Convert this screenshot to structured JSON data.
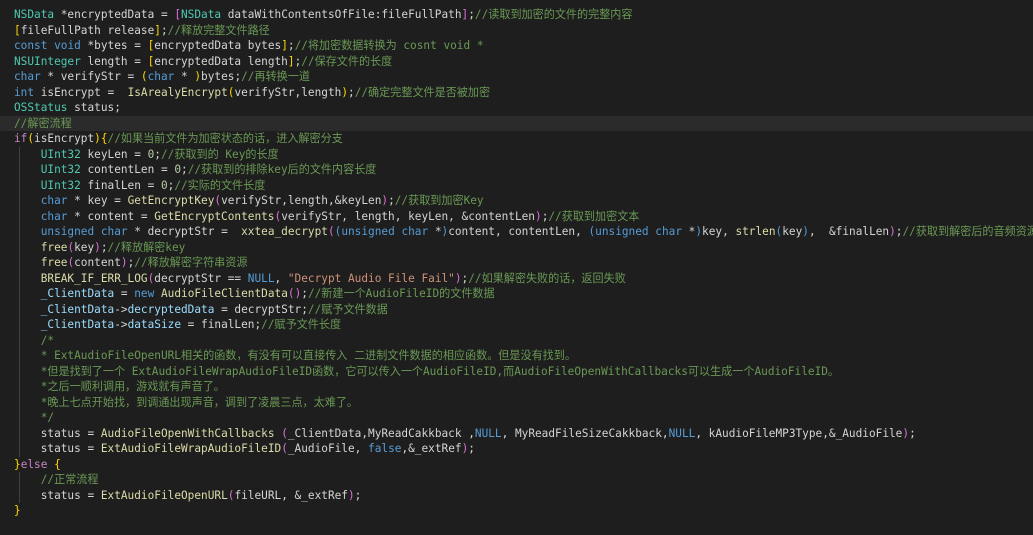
{
  "colors": {
    "background": "#1e1e1e",
    "default": "#d4d4d4",
    "type": "#4ec9b0",
    "keyword": "#569cd6",
    "control": "#c586c0",
    "function": "#dcdcaa",
    "variable": "#9cdcfe",
    "string": "#ce9178",
    "number": "#b5cea8",
    "comment": "#6a9955",
    "brace": "#ffd700",
    "paren": "#da70d6",
    "indent_guide": "#404040",
    "current_line": "#2b2b2b"
  },
  "lines": [
    {
      "indent": 0,
      "tokens": [
        [
          "NSData",
          "type"
        ],
        [
          " *encryptedData = ",
          "default"
        ],
        [
          "[",
          "paren"
        ],
        [
          "NSData",
          "type"
        ],
        [
          " dataWithContentsOfFile:fileFullPath",
          "default"
        ],
        [
          "]",
          "paren"
        ],
        [
          ";",
          "default"
        ],
        [
          "//读取到加密的文件的完整内容",
          "comment"
        ]
      ]
    },
    {
      "indent": 0,
      "tokens": [
        [
          "[",
          "brace"
        ],
        [
          "fileFullPath release",
          "default"
        ],
        [
          "]",
          "brace"
        ],
        [
          ";",
          "default"
        ],
        [
          "//释放完整文件路径",
          "comment"
        ]
      ]
    },
    {
      "indent": 0,
      "tokens": [
        [
          "const",
          "keyword"
        ],
        [
          " ",
          "default"
        ],
        [
          "void",
          "keyword"
        ],
        [
          " *bytes = ",
          "default"
        ],
        [
          "[",
          "brace"
        ],
        [
          "encryptedData bytes",
          "default"
        ],
        [
          "]",
          "brace"
        ],
        [
          ";",
          "default"
        ],
        [
          "//将加密数据转换为 cosnt void *",
          "comment"
        ]
      ]
    },
    {
      "indent": 0,
      "tokens": [
        [
          "NSUInteger",
          "type"
        ],
        [
          " length = ",
          "default"
        ],
        [
          "[",
          "brace"
        ],
        [
          "encryptedData length",
          "default"
        ],
        [
          "]",
          "brace"
        ],
        [
          ";",
          "default"
        ],
        [
          "//保存文件的长度",
          "comment"
        ]
      ]
    },
    {
      "indent": 0,
      "tokens": [
        [
          "char",
          "keyword"
        ],
        [
          " * verifyStr = ",
          "default"
        ],
        [
          "(",
          "brace"
        ],
        [
          "char",
          "keyword"
        ],
        [
          " * ",
          "default"
        ],
        [
          ")",
          "brace"
        ],
        [
          "bytes;",
          "default"
        ],
        [
          "//再转换一道",
          "comment"
        ]
      ]
    },
    {
      "indent": 0,
      "tokens": [
        [
          "int",
          "keyword"
        ],
        [
          " isEncrypt =  ",
          "default"
        ],
        [
          "IsArealyEncrypt",
          "function"
        ],
        [
          "(",
          "brace"
        ],
        [
          "verifyStr,length",
          "default"
        ],
        [
          ")",
          "brace"
        ],
        [
          ";",
          "default"
        ],
        [
          "//确定完整文件是否被加密",
          "comment"
        ]
      ]
    },
    {
      "indent": 0,
      "tokens": [
        [
          "OSStatus",
          "type"
        ],
        [
          " status;",
          "default"
        ]
      ]
    },
    {
      "indent": 0,
      "highlight": true,
      "tokens": [
        [
          "//解密流程",
          "comment"
        ]
      ]
    },
    {
      "indent": 0,
      "tokens": [
        [
          "if",
          "control"
        ],
        [
          "(",
          "brace"
        ],
        [
          "isEncrypt",
          "default"
        ],
        [
          ")",
          "brace"
        ],
        [
          "{",
          "brace"
        ],
        [
          "//如果当前文件为加密状态的话，进入解密分支",
          "comment"
        ]
      ]
    },
    {
      "indent": 1,
      "tokens": [
        [
          "UInt32",
          "type"
        ],
        [
          " keyLen = ",
          "default"
        ],
        [
          "0",
          "number"
        ],
        [
          ";",
          "default"
        ],
        [
          "//获取到的 Key的长度",
          "comment"
        ]
      ]
    },
    {
      "indent": 1,
      "tokens": [
        [
          "UInt32",
          "type"
        ],
        [
          " contentLen = ",
          "default"
        ],
        [
          "0",
          "number"
        ],
        [
          ";",
          "default"
        ],
        [
          "//获取到的排除key后的文件内容长度",
          "comment"
        ]
      ]
    },
    {
      "indent": 1,
      "tokens": [
        [
          "UInt32",
          "type"
        ],
        [
          " finalLen = ",
          "default"
        ],
        [
          "0",
          "number"
        ],
        [
          ";",
          "default"
        ],
        [
          "//实际的文件长度",
          "comment"
        ]
      ]
    },
    {
      "indent": 1,
      "tokens": [
        [
          "char",
          "keyword"
        ],
        [
          " * key = ",
          "default"
        ],
        [
          "GetEncryptKey",
          "function"
        ],
        [
          "(",
          "paren"
        ],
        [
          "verifyStr,length,&keyLen",
          "default"
        ],
        [
          ")",
          "paren"
        ],
        [
          ";",
          "default"
        ],
        [
          "//获取到加密Key",
          "comment"
        ]
      ]
    },
    {
      "indent": 1,
      "tokens": [
        [
          "char",
          "keyword"
        ],
        [
          " * content = ",
          "default"
        ],
        [
          "GetEncryptContents",
          "function"
        ],
        [
          "(",
          "paren"
        ],
        [
          "verifyStr, length, keyLen, &contentLen",
          "default"
        ],
        [
          ")",
          "paren"
        ],
        [
          ";",
          "default"
        ],
        [
          "//获取到加密文本",
          "comment"
        ]
      ]
    },
    {
      "indent": 1,
      "tokens": [
        [
          "unsigned",
          "keyword"
        ],
        [
          " ",
          "default"
        ],
        [
          "char",
          "keyword"
        ],
        [
          " * decryptStr =  ",
          "default"
        ],
        [
          "xxtea_decrypt",
          "function"
        ],
        [
          "(",
          "paren"
        ],
        [
          "(",
          "keyword"
        ],
        [
          "unsigned",
          "keyword"
        ],
        [
          " ",
          "default"
        ],
        [
          "char",
          "keyword"
        ],
        [
          " *",
          "default"
        ],
        [
          ")",
          "keyword"
        ],
        [
          "content, contentLen, ",
          "default"
        ],
        [
          "(",
          "keyword"
        ],
        [
          "unsigned",
          "keyword"
        ],
        [
          " ",
          "default"
        ],
        [
          "char",
          "keyword"
        ],
        [
          " *",
          "default"
        ],
        [
          ")",
          "keyword"
        ],
        [
          "key, ",
          "default"
        ],
        [
          "strlen",
          "function"
        ],
        [
          "(",
          "keyword"
        ],
        [
          "key",
          "default"
        ],
        [
          ")",
          "keyword"
        ],
        [
          ",  &finalLen",
          "default"
        ],
        [
          ")",
          "paren"
        ],
        [
          ";",
          "default"
        ],
        [
          "//获取到解密后的音频资源信息",
          "comment"
        ]
      ]
    },
    {
      "indent": 1,
      "tokens": [
        [
          "free",
          "function"
        ],
        [
          "(",
          "paren"
        ],
        [
          "key",
          "default"
        ],
        [
          ")",
          "paren"
        ],
        [
          ";",
          "default"
        ],
        [
          "//释放解密key",
          "comment"
        ]
      ]
    },
    {
      "indent": 1,
      "tokens": [
        [
          "free",
          "function"
        ],
        [
          "(",
          "paren"
        ],
        [
          "content",
          "default"
        ],
        [
          ")",
          "paren"
        ],
        [
          ";",
          "default"
        ],
        [
          "//释放解密字符串资源",
          "comment"
        ]
      ]
    },
    {
      "indent": 1,
      "tokens": [
        [
          "BREAK_IF_ERR_LOG",
          "function"
        ],
        [
          "(",
          "paren"
        ],
        [
          "decryptStr == ",
          "default"
        ],
        [
          "NULL",
          "keyword"
        ],
        [
          ", ",
          "default"
        ],
        [
          "\"Decrypt Audio File Fail\"",
          "string"
        ],
        [
          ")",
          "paren"
        ],
        [
          ";",
          "default"
        ],
        [
          "//如果解密失败的话，返回失败",
          "comment"
        ]
      ]
    },
    {
      "indent": 1,
      "tokens": [
        [
          "_ClientData",
          "variable"
        ],
        [
          " = ",
          "default"
        ],
        [
          "new",
          "keyword"
        ],
        [
          " ",
          "default"
        ],
        [
          "AudioFileClientData",
          "function"
        ],
        [
          "()",
          "paren"
        ],
        [
          ";",
          "default"
        ],
        [
          "//新建一个AudioFileID的文件数据",
          "comment"
        ]
      ]
    },
    {
      "indent": 1,
      "tokens": [
        [
          "_ClientData",
          "variable"
        ],
        [
          "->",
          "default"
        ],
        [
          "decryptedData",
          "variable"
        ],
        [
          " = decryptStr;",
          "default"
        ],
        [
          "//赋予文件数据",
          "comment"
        ]
      ]
    },
    {
      "indent": 1,
      "tokens": [
        [
          "_ClientData",
          "variable"
        ],
        [
          "->",
          "default"
        ],
        [
          "dataSize",
          "variable"
        ],
        [
          " = finalLen;",
          "default"
        ],
        [
          "//赋予文件长度",
          "comment"
        ]
      ]
    },
    {
      "indent": 1,
      "tokens": [
        [
          "/*",
          "comment"
        ]
      ]
    },
    {
      "indent": 1,
      "tokens": [
        [
          "* ExtAudioFileOpenURL相关的函数，有没有可以直接传入 二进制文件数据的相应函数。但是没有找到。",
          "comment"
        ]
      ]
    },
    {
      "indent": 1,
      "tokens": [
        [
          "*但是找到了一个 ExtAudioFileWrapAudioFileID函数，它可以传入一个AudioFileID,而AudioFileOpenWithCallbacks可以生成一个AudioFileID。",
          "comment"
        ]
      ]
    },
    {
      "indent": 1,
      "tokens": [
        [
          "*之后一顺利调用，游戏就有声音了。",
          "comment"
        ]
      ]
    },
    {
      "indent": 1,
      "tokens": [
        [
          "*晚上七点开始找，到调通出现声音，调到了凌晨三点，太难了。",
          "comment"
        ]
      ]
    },
    {
      "indent": 1,
      "tokens": [
        [
          "*/",
          "comment"
        ]
      ]
    },
    {
      "indent": 1,
      "tokens": [
        [
          "status = ",
          "default"
        ],
        [
          "AudioFileOpenWithCallbacks",
          "function"
        ],
        [
          " ",
          "default"
        ],
        [
          "(",
          "paren"
        ],
        [
          "_ClientData,MyReadCakkback ,",
          "default"
        ],
        [
          "NULL",
          "keyword"
        ],
        [
          ", MyReadFileSizeCakkback,",
          "default"
        ],
        [
          "NULL",
          "keyword"
        ],
        [
          ", kAudioFileMP3Type,&_AudioFile",
          "default"
        ],
        [
          ")",
          "paren"
        ],
        [
          ";",
          "default"
        ]
      ]
    },
    {
      "indent": 1,
      "tokens": [
        [
          "status = ",
          "default"
        ],
        [
          "ExtAudioFileWrapAudioFileID",
          "function"
        ],
        [
          "(",
          "paren"
        ],
        [
          "_AudioFile, ",
          "default"
        ],
        [
          "false",
          "keyword"
        ],
        [
          ",&_extRef",
          "default"
        ],
        [
          ")",
          "paren"
        ],
        [
          ";",
          "default"
        ]
      ]
    },
    {
      "indent": 0,
      "tokens": [
        [
          "}",
          "brace"
        ],
        [
          "else",
          "control"
        ],
        [
          " ",
          "default"
        ],
        [
          "{",
          "brace"
        ]
      ]
    },
    {
      "indent": 1,
      "tokens": [
        [
          "//正常流程",
          "comment"
        ]
      ]
    },
    {
      "indent": 1,
      "tokens": [
        [
          "status = ",
          "default"
        ],
        [
          "ExtAudioFileOpenURL",
          "function"
        ],
        [
          "(",
          "paren"
        ],
        [
          "fileURL, &_extRef",
          "default"
        ],
        [
          ")",
          "paren"
        ],
        [
          ";",
          "default"
        ]
      ]
    },
    {
      "indent": 0,
      "tokens": [
        [
          "}",
          "brace"
        ]
      ]
    }
  ]
}
